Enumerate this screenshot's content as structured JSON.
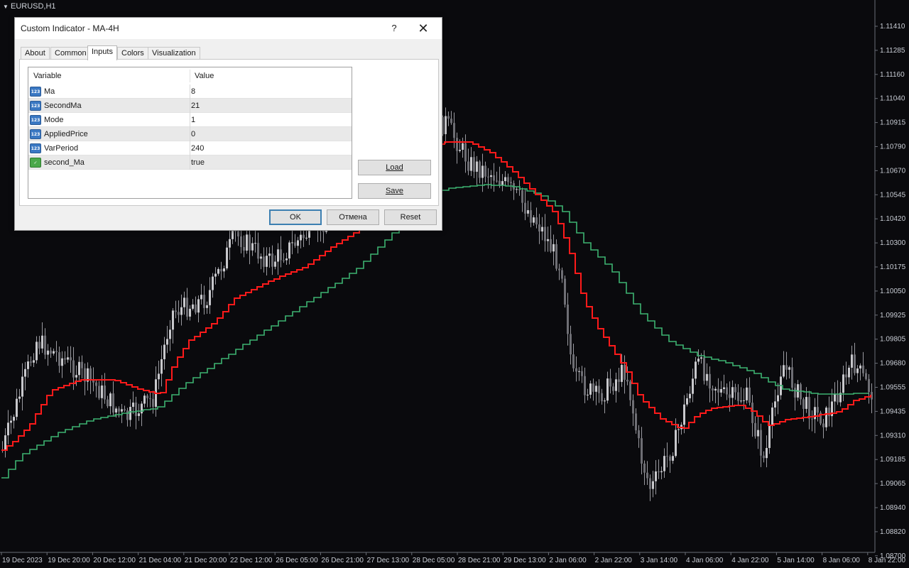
{
  "chart": {
    "symbol": "EURUSD,H1",
    "price_labels": [
      "1.11410",
      "1.11285",
      "1.11160",
      "1.11040",
      "1.10915",
      "1.10790",
      "1.10670",
      "1.10545",
      "1.10420",
      "1.10300",
      "1.10175",
      "1.10050",
      "1.09925",
      "1.09805",
      "1.09680",
      "1.09555",
      "1.09435",
      "1.09310",
      "1.09185",
      "1.09065",
      "1.08940",
      "1.08820",
      "1.08700"
    ],
    "time_labels": [
      "19 Dec 2023",
      "19 Dec 20:00",
      "20 Dec 12:00",
      "21 Dec 04:00",
      "21 Dec 20:00",
      "22 Dec 12:00",
      "26 Dec 05:00",
      "26 Dec 21:00",
      "27 Dec 13:00",
      "28 Dec 05:00",
      "28 Dec 21:00",
      "29 Dec 13:00",
      "2 Jan 06:00",
      "2 Jan 22:00",
      "3 Jan 14:00",
      "4 Jan 06:00",
      "4 Jan 22:00",
      "5 Jan 14:00",
      "8 Jan 06:00",
      "8 Jan 22:00"
    ],
    "colors": {
      "background": "#0a0a0d",
      "candles": "#9a9aa0",
      "fast_ma": "#ff1a1a",
      "slow_ma": "#3cb371"
    }
  },
  "dialog": {
    "title": "Custom Indicator - MA-4H",
    "help_label": "?",
    "close_icon": "close-icon",
    "tabs": [
      "About",
      "Common",
      "Inputs",
      "Colors",
      "Visualization"
    ],
    "active_tab": "Inputs",
    "table": {
      "headers": [
        "Variable",
        "Value"
      ],
      "rows": [
        {
          "type": "123",
          "name": "Ma",
          "value": "8"
        },
        {
          "type": "123",
          "name": "SecondMa",
          "value": "21"
        },
        {
          "type": "123",
          "name": "Mode",
          "value": "1"
        },
        {
          "type": "123",
          "name": "AppliedPrice",
          "value": "0"
        },
        {
          "type": "123",
          "name": "VarPeriod",
          "value": "240"
        },
        {
          "type": "bool",
          "name": "second_Ma",
          "value": "true"
        }
      ]
    },
    "load_label": "Load",
    "save_label": "Save",
    "ok_label": "OK",
    "cancel_label": "Отмена",
    "reset_label": "Reset"
  }
}
